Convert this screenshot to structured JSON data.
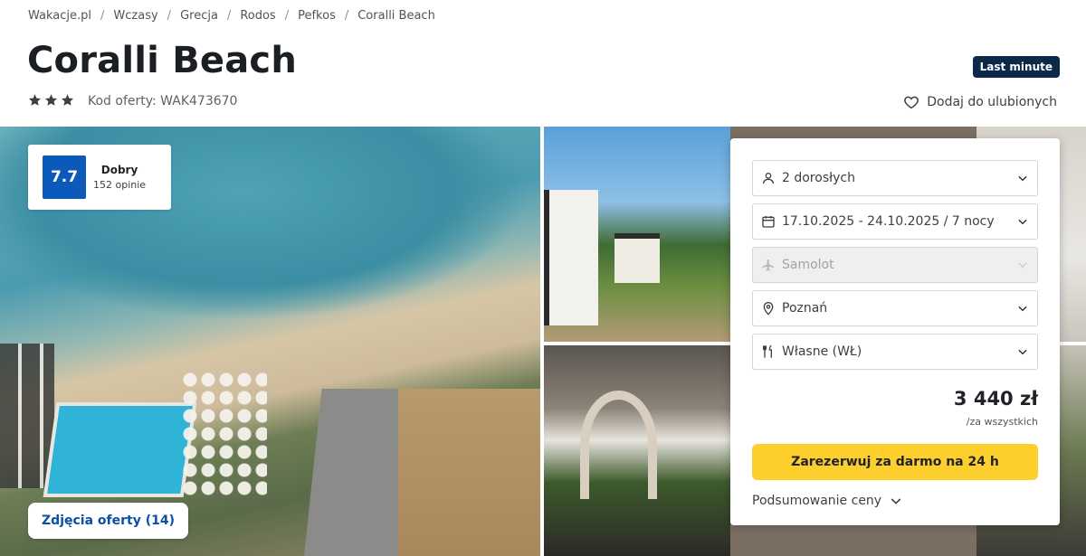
{
  "breadcrumb": [
    "Wakacje.pl",
    "Wczasy",
    "Grecja",
    "Rodos",
    "Pefkos",
    "Coralli Beach"
  ],
  "breadcrumb_separator": "/",
  "hotel": {
    "title": "Coralli Beach",
    "stars": 3,
    "offer_code": "Kod oferty: WAK473670"
  },
  "badge": "Last minute",
  "favorite_label": "Dodaj do ulubionych",
  "rating": {
    "score": "7.7",
    "label": "Dobry",
    "count": "152 opinie"
  },
  "gallery": {
    "photos_button": "Zdjęcia oferty (14)"
  },
  "booking": {
    "travelers": "2 dorosłych",
    "dates": "17.10.2025 - 24.10.2025 / 7 nocy",
    "transport": "Samolot",
    "departure": "Poznań",
    "board": "Własne (WŁ)",
    "price": "3 440 zł",
    "price_note": "/za wszystkich",
    "book_button": "Zarezerwuj za darmo na 24 h",
    "summary_label": "Podsumowanie ceny"
  },
  "colors": {
    "rating_blue": "#0b59b8",
    "badge_navy": "#0b2a4a",
    "cta_yellow": "#fdcf2c",
    "link_blue": "#0b4fa8"
  }
}
